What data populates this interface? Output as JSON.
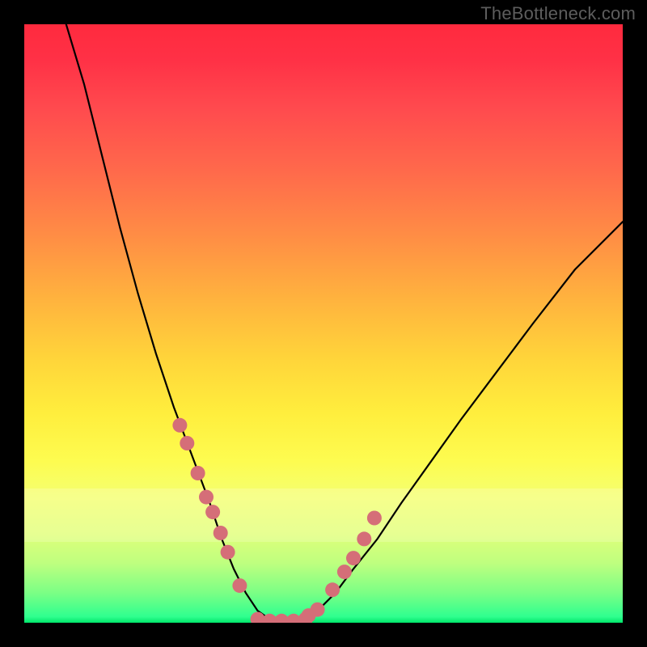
{
  "watermark": "TheBottleneck.com",
  "chart_data": {
    "type": "line",
    "title": "",
    "xlabel": "",
    "ylabel": "",
    "xlim": [
      0,
      100
    ],
    "ylim": [
      0,
      100
    ],
    "left_curve": {
      "x": [
        7,
        10,
        13,
        16,
        19,
        22,
        25,
        28,
        31,
        33,
        35,
        37,
        39,
        41,
        43
      ],
      "y": [
        100,
        90,
        78,
        66,
        55,
        45,
        36,
        28,
        20,
        14,
        9,
        5,
        2,
        0.6,
        0
      ]
    },
    "right_curve": {
      "x": [
        43,
        46,
        49,
        52,
        55,
        59,
        63,
        68,
        73,
        79,
        85,
        92,
        100
      ],
      "y": [
        0,
        0.4,
        2,
        5,
        9,
        14,
        20,
        27,
        34,
        42,
        50,
        59,
        67
      ]
    },
    "left_dots": {
      "x": [
        26.0,
        27.2,
        29.0,
        30.4,
        31.5,
        32.8,
        34.0,
        36.0
      ],
      "y": [
        33.0,
        30.0,
        25.0,
        21.0,
        18.5,
        15.0,
        11.8,
        6.2
      ]
    },
    "right_dots": {
      "x": [
        47.5,
        49.0,
        51.5,
        53.5,
        55.0,
        56.8,
        58.5
      ],
      "y": [
        1.2,
        2.2,
        5.5,
        8.5,
        10.8,
        14.0,
        17.5
      ]
    },
    "bottom_dots": {
      "x": [
        39.0,
        41.0,
        43.0,
        45.0,
        47.0
      ],
      "y": [
        0.6,
        0.3,
        0.3,
        0.3,
        0.6
      ]
    },
    "dot_color": "#d56e78",
    "curve_color": "#000000"
  }
}
